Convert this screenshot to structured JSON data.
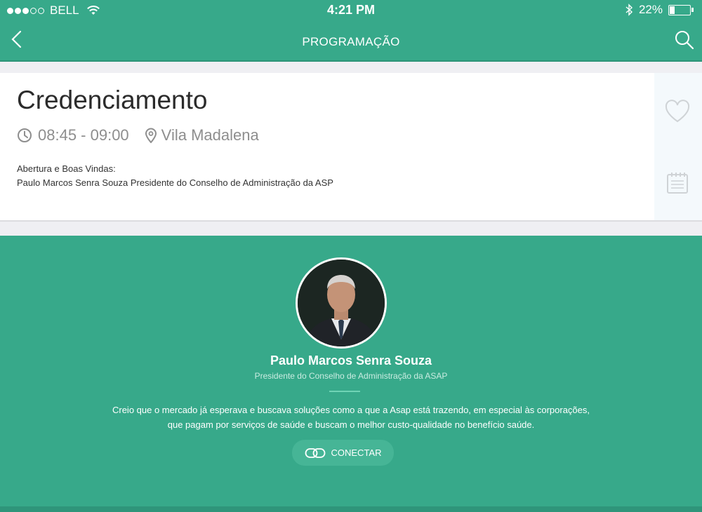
{
  "status_bar": {
    "carrier": "BELL",
    "time": "4:21 PM",
    "battery": "22%",
    "battery_level": 0.22,
    "signal_bars": 3,
    "signal_total": 5,
    "icons": [
      "wifi-icon",
      "bluetooth-icon",
      "battery-icon"
    ]
  },
  "nav": {
    "title": "PROGRAMAÇÃO",
    "back_icon": "chevron-left-icon",
    "search_icon": "search-icon"
  },
  "event": {
    "title": "Credenciamento",
    "time": "08:45 - 09:00",
    "location": "Vila Madalena",
    "description_lines": [
      "Abertura e Boas Vindas:",
      "Paulo Marcos Senra Souza Presidente do Conselho de Administração da ASP"
    ],
    "icons": [
      "clock-icon",
      "location-pin-icon",
      "heart-icon",
      "calendar-icon"
    ]
  },
  "speaker": {
    "name": "Paulo Marcos Senra Souza",
    "role": "Presidente do Conselho de Administração da ASAP",
    "quote_lines": [
      "Creio que o mercado já esperava e buscava soluções como a que a Asap está trazendo, em especial às corporações,",
      "que pagam por serviços de saúde e buscam o melhor custo-qualidade no benefício saúde."
    ],
    "connect_label": "CONECTAR",
    "connect_icon": "link-icon"
  },
  "colors": {
    "brand": "#37a98a",
    "brand_dark": "#2f957a",
    "text_dark": "#2b2b2b",
    "text_muted": "#8e8e8e"
  }
}
